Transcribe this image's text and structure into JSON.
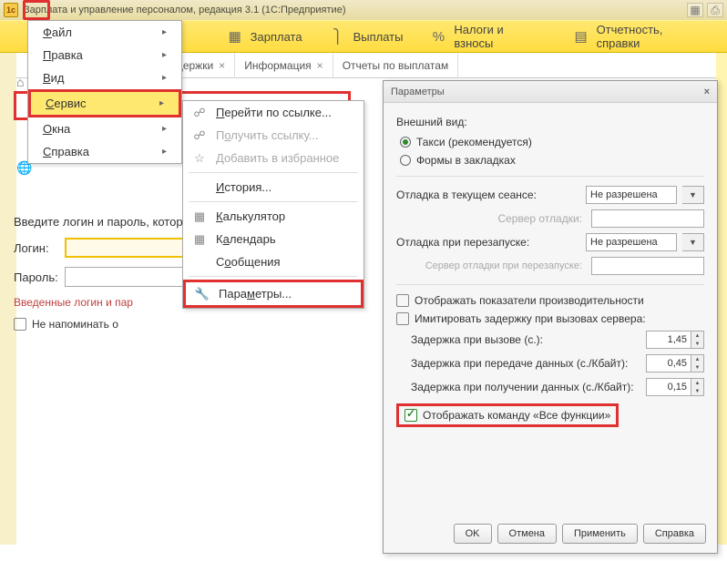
{
  "title": "Зарплата и управление персоналом, редакция 3.1  (1С:Предприятие)",
  "ribbon": [
    {
      "icon": "▦",
      "label": "Зарплата"
    },
    {
      "icon": "⎫",
      "label": "Выплаты"
    },
    {
      "icon": "%",
      "label": "Налоги и взносы"
    },
    {
      "icon": "▤",
      "label": "Отчетность, справки"
    }
  ],
  "tabs": [
    {
      "label": "одключение Интернет-поддержки",
      "close": "×"
    },
    {
      "label": "Информация",
      "close": "×"
    },
    {
      "label": "Отчеты по выплатам"
    }
  ],
  "login": {
    "prompt": "Введите логин и пароль, котор",
    "login_label": "Логин:",
    "password_label": "Пароль:",
    "note": "Введенные логин и пар",
    "remind": "Не напоминать о"
  },
  "menu1": [
    {
      "label": "Файл",
      "u": "Ф"
    },
    {
      "label": "Правка",
      "u": "П"
    },
    {
      "label": "Вид",
      "u": "В"
    },
    {
      "label": "Сервис",
      "u": "С",
      "hl": true
    },
    {
      "label": "Окна",
      "u": "О"
    },
    {
      "label": "Справка",
      "u": "С"
    }
  ],
  "menu2": [
    {
      "icon": "🔗",
      "label": "Перейти по ссылке...",
      "u": "П"
    },
    {
      "icon": "🔗",
      "label": "Получить ссылку...",
      "u": "о",
      "disabled": true
    },
    {
      "icon": "☆",
      "label": "Добавить в избранное",
      "u": "Д",
      "disabled": true
    },
    {
      "sep": true
    },
    {
      "icon": "",
      "label": "История...",
      "u": "И"
    },
    {
      "sep": true
    },
    {
      "icon": "▦",
      "label": "Калькулятор",
      "u": "К"
    },
    {
      "icon": "▦",
      "label": "Календарь",
      "u": "а"
    },
    {
      "icon": "",
      "label": "Сообщения",
      "u": "о"
    },
    {
      "sep": true
    },
    {
      "icon": "🔧",
      "label": "Параметры...",
      "u": "м",
      "hl": true
    }
  ],
  "dialog": {
    "title": "Параметры",
    "appearance_label": "Внешний вид:",
    "radio_taxi": "Такси (рекомендуется)",
    "radio_tabs": "Формы в закладках",
    "debug_session_label": "Отладка в текущем сеансе:",
    "debug_session_value": "Не разрешена",
    "debug_server_label": "Сервер отладки:",
    "debug_restart_label": "Отладка при перезапуске:",
    "debug_restart_value": "Не разрешена",
    "debug_server_restart_label": "Сервер отладки при перезапуске:",
    "chk_perf": "Отображать показатели производительности",
    "chk_delay": "Имитировать задержку при вызовах сервера:",
    "delay_call_label": "Задержка при вызове (с.):",
    "delay_call_value": "1,45",
    "delay_send_label": "Задержка при передаче данных (с./Кбайт):",
    "delay_send_value": "0,45",
    "delay_recv_label": "Задержка при получении данных (с./Кбайт):",
    "delay_recv_value": "0,15",
    "chk_allfn": "Отображать команду «Все функции»",
    "btn_ok": "OK",
    "btn_cancel": "Отмена",
    "btn_apply": "Применить",
    "btn_help": "Справка"
  }
}
